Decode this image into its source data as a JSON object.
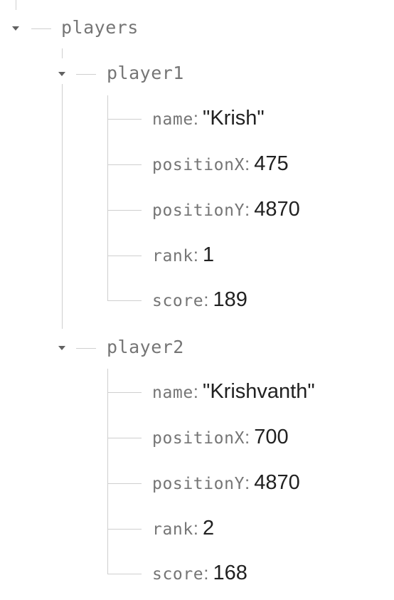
{
  "tree": {
    "root": {
      "key": "players",
      "children": [
        {
          "key": "player1",
          "fields": [
            {
              "key": "name",
              "value": "\"Krish\""
            },
            {
              "key": "positionX",
              "value": "475"
            },
            {
              "key": "positionY",
              "value": "4870"
            },
            {
              "key": "rank",
              "value": "1"
            },
            {
              "key": "score",
              "value": "189"
            }
          ]
        },
        {
          "key": "player2",
          "fields": [
            {
              "key": "name",
              "value": "\"Krishvanth\""
            },
            {
              "key": "positionX",
              "value": "700"
            },
            {
              "key": "positionY",
              "value": "4870"
            },
            {
              "key": "rank",
              "value": "2"
            },
            {
              "key": "score",
              "value": "168"
            }
          ]
        }
      ]
    },
    "separator": ":"
  },
  "icons": {
    "expand_toggle": "caret-down-icon"
  },
  "colors": {
    "key": "#757575",
    "value": "#212121",
    "connector": "#cfcfcf",
    "caret": "#616161"
  }
}
